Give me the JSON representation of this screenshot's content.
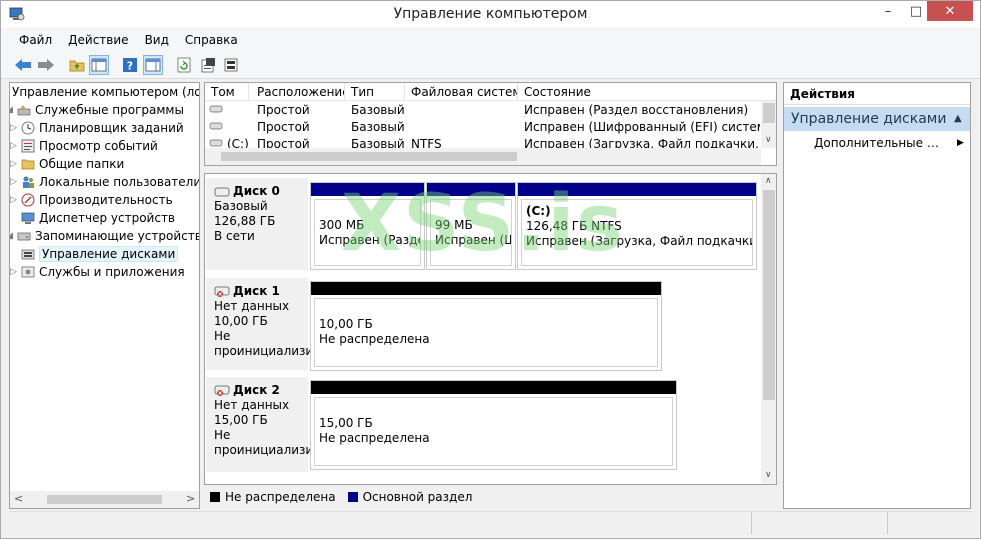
{
  "window": {
    "title": "Управление компьютером",
    "minimize": "–",
    "maximize": "□",
    "close": "✕"
  },
  "menu": [
    "Файл",
    "Действие",
    "Вид",
    "Справка"
  ],
  "tree": {
    "root": "Управление компьютером (локальным)",
    "items": [
      {
        "label": "Служебные программы",
        "icon": "tools-icon"
      },
      {
        "label": "Планировщик заданий",
        "icon": "clock-icon"
      },
      {
        "label": "Просмотр событий",
        "icon": "event-viewer-icon"
      },
      {
        "label": "Общие папки",
        "icon": "shared-folder-icon"
      },
      {
        "label": "Локальные пользователи и группы",
        "icon": "users-icon"
      },
      {
        "label": "Производительность",
        "icon": "performance-icon"
      },
      {
        "label": "Диспетчер устройств",
        "icon": "device-manager-icon"
      },
      {
        "label": "Запоминающие устройства",
        "icon": "storage-icon"
      },
      {
        "label": "Управление дисками",
        "icon": "disk-management-icon"
      },
      {
        "label": "Службы и приложения",
        "icon": "services-icon"
      }
    ]
  },
  "volume_list": {
    "columns": [
      "Том",
      "Расположение",
      "Тип",
      "Файловая система",
      "Состояние"
    ],
    "rows": [
      {
        "tom": "",
        "layout": "Простой",
        "type": "Базовый",
        "fs": "",
        "status": "Исправен (Раздел восстановления)"
      },
      {
        "tom": "",
        "layout": "Простой",
        "type": "Базовый",
        "fs": "",
        "status": "Исправен (Шифрованный (EFI) системный раздел)"
      },
      {
        "tom": "(C:)",
        "layout": "Простой",
        "type": "Базовый",
        "fs": "NTFS",
        "status": "Исправен (Загрузка, Файл подкачки, Аварийный дамп)"
      }
    ]
  },
  "disks": [
    {
      "name": "Диск 0",
      "kind": "Базовый",
      "size": "126,88 ГБ",
      "state": "В сети",
      "partitions": [
        {
          "title": "",
          "size": "300 МБ",
          "status": "Исправен (Раздел восстановления)"
        },
        {
          "title": "",
          "size": "99 МБ",
          "status": "Исправен (Шифрованный (EFI))"
        },
        {
          "title": "(C:)",
          "size": "126,48 ГБ NTFS",
          "status": "Исправен (Загрузка, Файл подкачки, Аварийный дамп)"
        }
      ]
    },
    {
      "name": "Диск 1",
      "kind": "Нет данных",
      "size": "10,00 ГБ",
      "state": "Не проинициализирован",
      "partitions": [
        {
          "title": "",
          "size": "10,00 ГБ",
          "status": "Не распределена"
        }
      ]
    },
    {
      "name": "Диск 2",
      "kind": "Нет данных",
      "size": "15,00 ГБ",
      "state": "Не проинициализирован",
      "partitions": [
        {
          "title": "",
          "size": "15,00 ГБ",
          "status": "Не распределена"
        }
      ]
    }
  ],
  "legend": {
    "unallocated": "Не распределена",
    "primary": "Основной раздел"
  },
  "actions": {
    "title": "Действия",
    "selected": "Управление дисками",
    "more": "Дополнительные действия"
  },
  "colors": {
    "primary_partition": "#00008b",
    "unallocated": "#000000",
    "selection": "#c5dcf0"
  },
  "watermark": "XSS.is"
}
